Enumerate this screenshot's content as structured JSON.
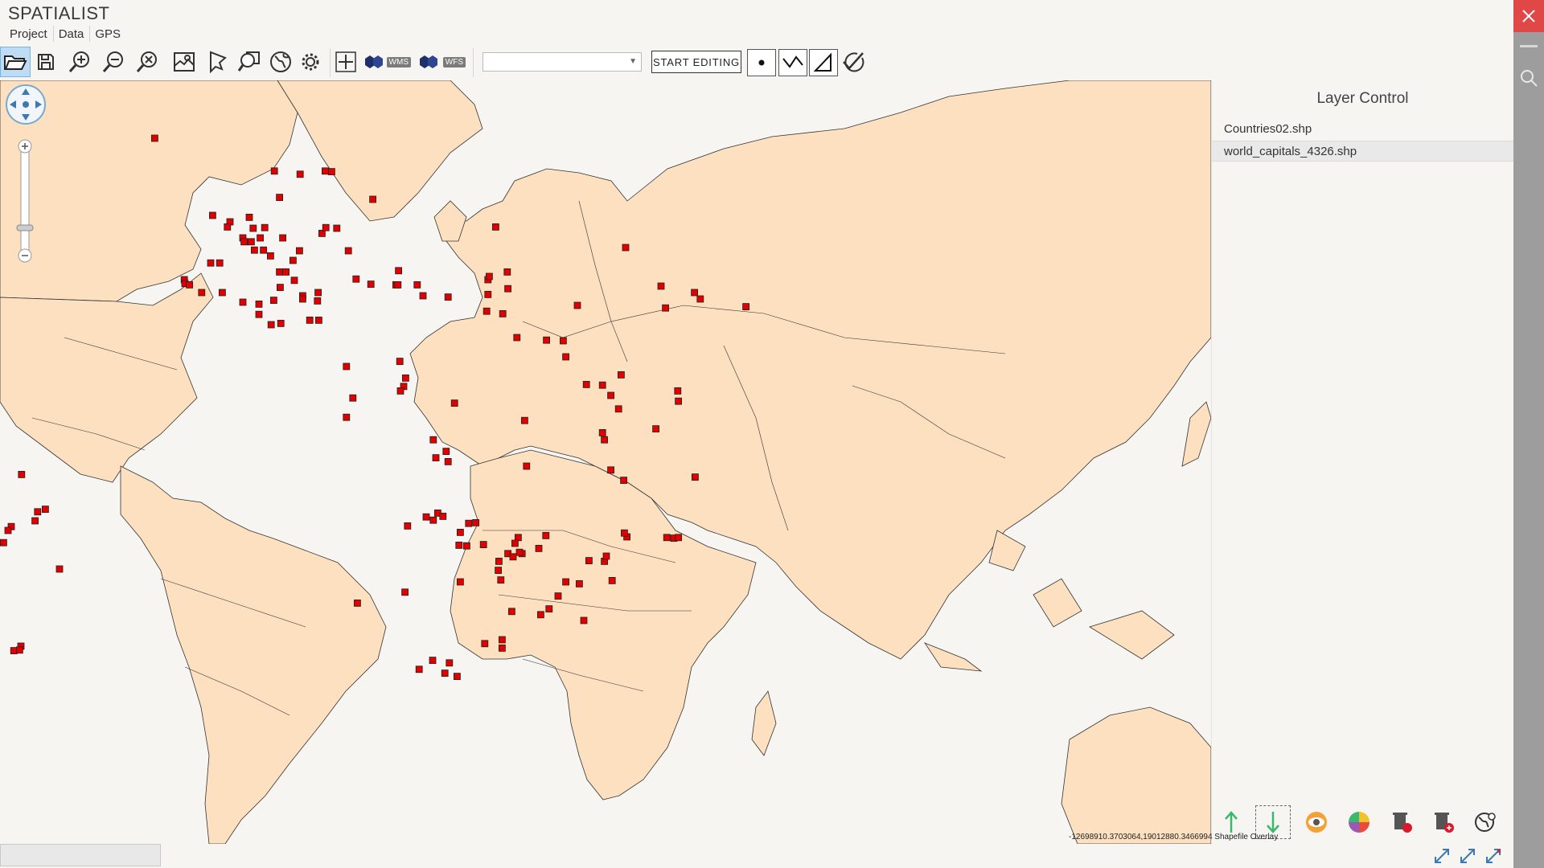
{
  "app": {
    "title": "SPATIALIST"
  },
  "menu": {
    "items": [
      "Project",
      "Data",
      "GPS"
    ]
  },
  "toolbar": {
    "tools": [
      {
        "name": "open-folder-icon",
        "active": true
      },
      {
        "name": "save-icon"
      },
      {
        "name": "zoom-in-icon"
      },
      {
        "name": "zoom-out-icon"
      },
      {
        "name": "zoom-extent-icon"
      },
      {
        "name": "map-layers-icon"
      },
      {
        "name": "identify-cursor-icon"
      },
      {
        "name": "search-zoom-icon"
      },
      {
        "name": "globe-icon"
      },
      {
        "name": "gear-icon"
      },
      {
        "name": "add-crosshair-icon"
      }
    ],
    "wms_label": "WMS",
    "wfs_label": "WFS",
    "layer_select_value": "",
    "start_editing_label": "START EDITING",
    "geometry_tools": [
      "point-icon",
      "line-icon",
      "polygon-icon",
      "check-icon"
    ]
  },
  "layer_control": {
    "title": "Layer Control",
    "layers": [
      "Countries02.shp",
      "world_capitals_4326.shp"
    ],
    "selected_index": 1,
    "tools": [
      "move-up-arrow-icon",
      "move-down-arrow-icon",
      "visibility-eye-icon",
      "color-wheel-icon",
      "delete-layer-icon",
      "remove-layer-icon",
      "globe-settings-icon"
    ]
  },
  "status": {
    "coordinates": "-12698910.3703064,19012880.3466994",
    "scale_text": "Shapefile Overlay"
  },
  "colors": {
    "land": "#fde0c0",
    "border": "#333333",
    "capital_marker": "#e00000",
    "sea": "#f6f5f2",
    "active_tool": "#bfdcf4",
    "wms_badge": "#1e2f6a",
    "close_button": "#e04848"
  },
  "map": {
    "layer": "Countries02.shp",
    "points_layer": "world_capitals_4326.shp"
  }
}
